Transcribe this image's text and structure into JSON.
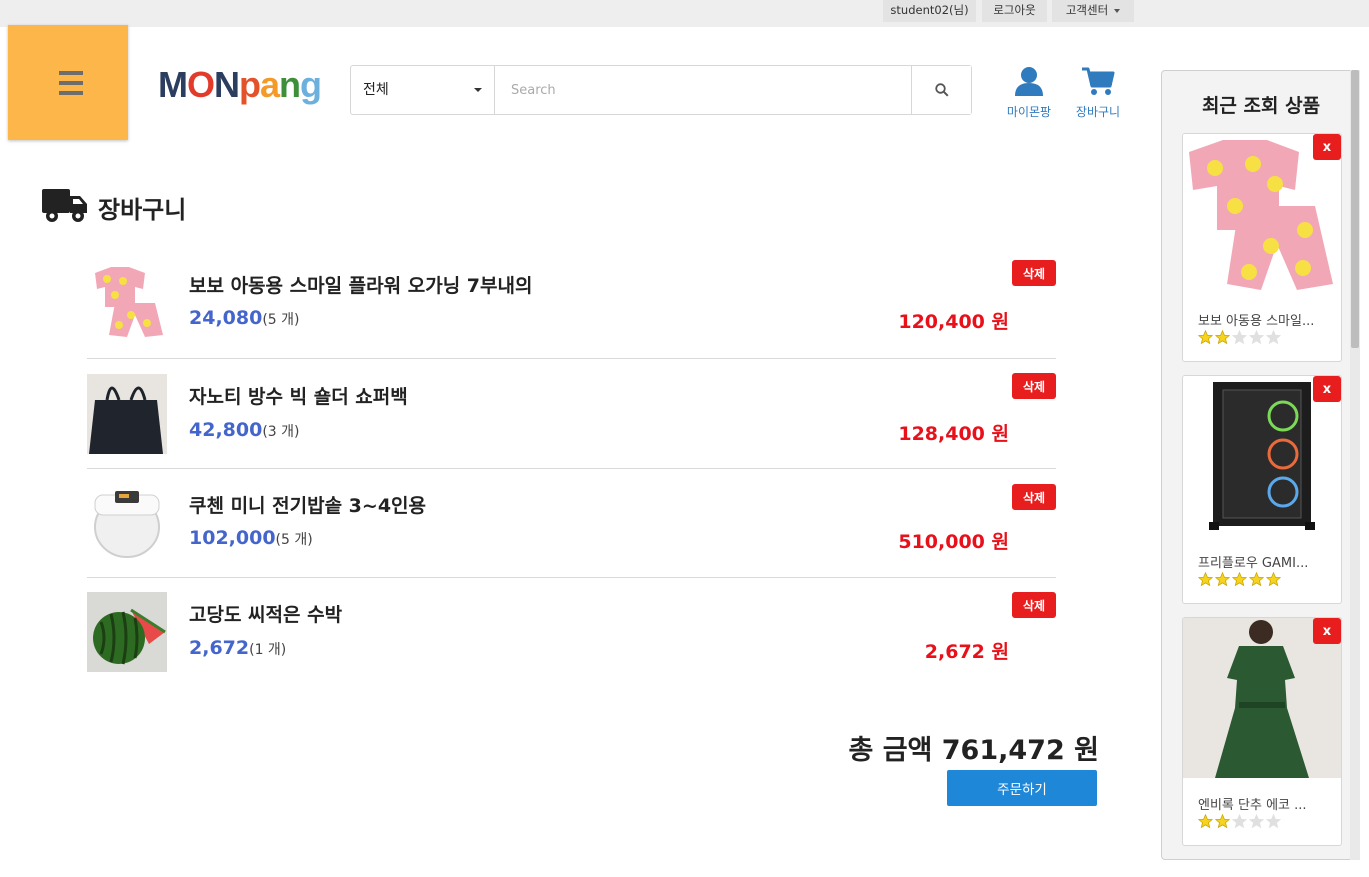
{
  "topbar": {
    "user": "student02(님)",
    "logout": "로그아웃",
    "customer_center": "고객센터"
  },
  "header": {
    "logo_text": "MONpang",
    "category_selected": "전체",
    "search_placeholder": "Search",
    "mypage_label": "마이몬팡",
    "cart_label": "장바구니",
    "icon_color": "#2f7bbd",
    "menu_color": "#fdb64a"
  },
  "cart": {
    "title": "장바구니",
    "delete_label": "삭제",
    "items": [
      {
        "name": "보보 아동용 스마일 플라워 오가닝 7부내의",
        "unit_price": "24,080",
        "qty": "(5 개)",
        "total": "120,400 원",
        "image": "pink-flower-pajamas"
      },
      {
        "name": "자노티 방수 빅 숄더 쇼퍼백",
        "unit_price": "42,800",
        "qty": "(3 개)",
        "total": "128,400 원",
        "image": "black-shopper-bag"
      },
      {
        "name": "쿠첸 미니 전기밥솥 3~4인용",
        "unit_price": "102,000",
        "qty": "(5 개)",
        "total": "510,000 원",
        "image": "white-rice-cooker"
      },
      {
        "name": "고당도 씨적은 수박",
        "unit_price": "2,672",
        "qty": "(1 개)",
        "total": "2,672 원",
        "image": "watermelon"
      }
    ],
    "grand_total": "총 금액 761,472 원",
    "order_button": "주문하기",
    "accent_price_color": "#4466cc",
    "accent_total_color": "#e8101a"
  },
  "recent": {
    "title": "최근 조회 상품",
    "close_label": "x",
    "items": [
      {
        "name": "보보 아동용 스마일...",
        "rating": 2,
        "image": "pink-flower-pajamas"
      },
      {
        "name": "프리플로우 GAMI...",
        "rating": 5,
        "image": "black-pc-case"
      },
      {
        "name": "엔비록 단추 에코 ...",
        "rating": 2,
        "image": "green-dress"
      }
    ]
  }
}
